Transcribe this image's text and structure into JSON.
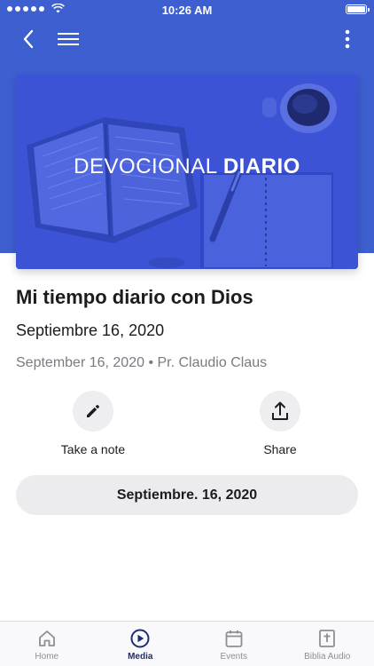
{
  "status_bar": {
    "time": "10:26 AM",
    "signal_bars": 5,
    "battery_level": 1.0
  },
  "nav": {
    "back_icon": "chevron-left-icon",
    "menu_icon": "hamburger-menu-icon",
    "more_icon": "vertical-dots-icon"
  },
  "banner": {
    "title_light": "DEVOCIONAL",
    "title_bold": "DIARIO"
  },
  "content": {
    "title": "Mi tiempo diario con Dios",
    "subtitle": "Septiembre 16, 2020",
    "meta": "September 16, 2020 • Pr. Claudio Claus"
  },
  "actions": [
    {
      "label": "Take a note",
      "icon": "pencil-icon"
    },
    {
      "label": "Share",
      "icon": "share-upload-icon"
    }
  ],
  "date_button": {
    "label": "Septiembre. 16, 2020"
  },
  "tab_bar": {
    "active_tab": "Media",
    "tabs": [
      {
        "label": "Home",
        "icon": "home-icon"
      },
      {
        "label": "Media",
        "icon": "play-circle-icon"
      },
      {
        "label": "Events",
        "icon": "calendar-icon"
      },
      {
        "label": "Biblia Audio",
        "icon": "bible-icon"
      }
    ]
  },
  "colors": {
    "header_blue": "#3d5fd0",
    "banner_blue": "#3b54d6",
    "active_tab": "#1c2c78",
    "inactive_tab": "#8e8e93",
    "pill_background": "#ececee"
  }
}
